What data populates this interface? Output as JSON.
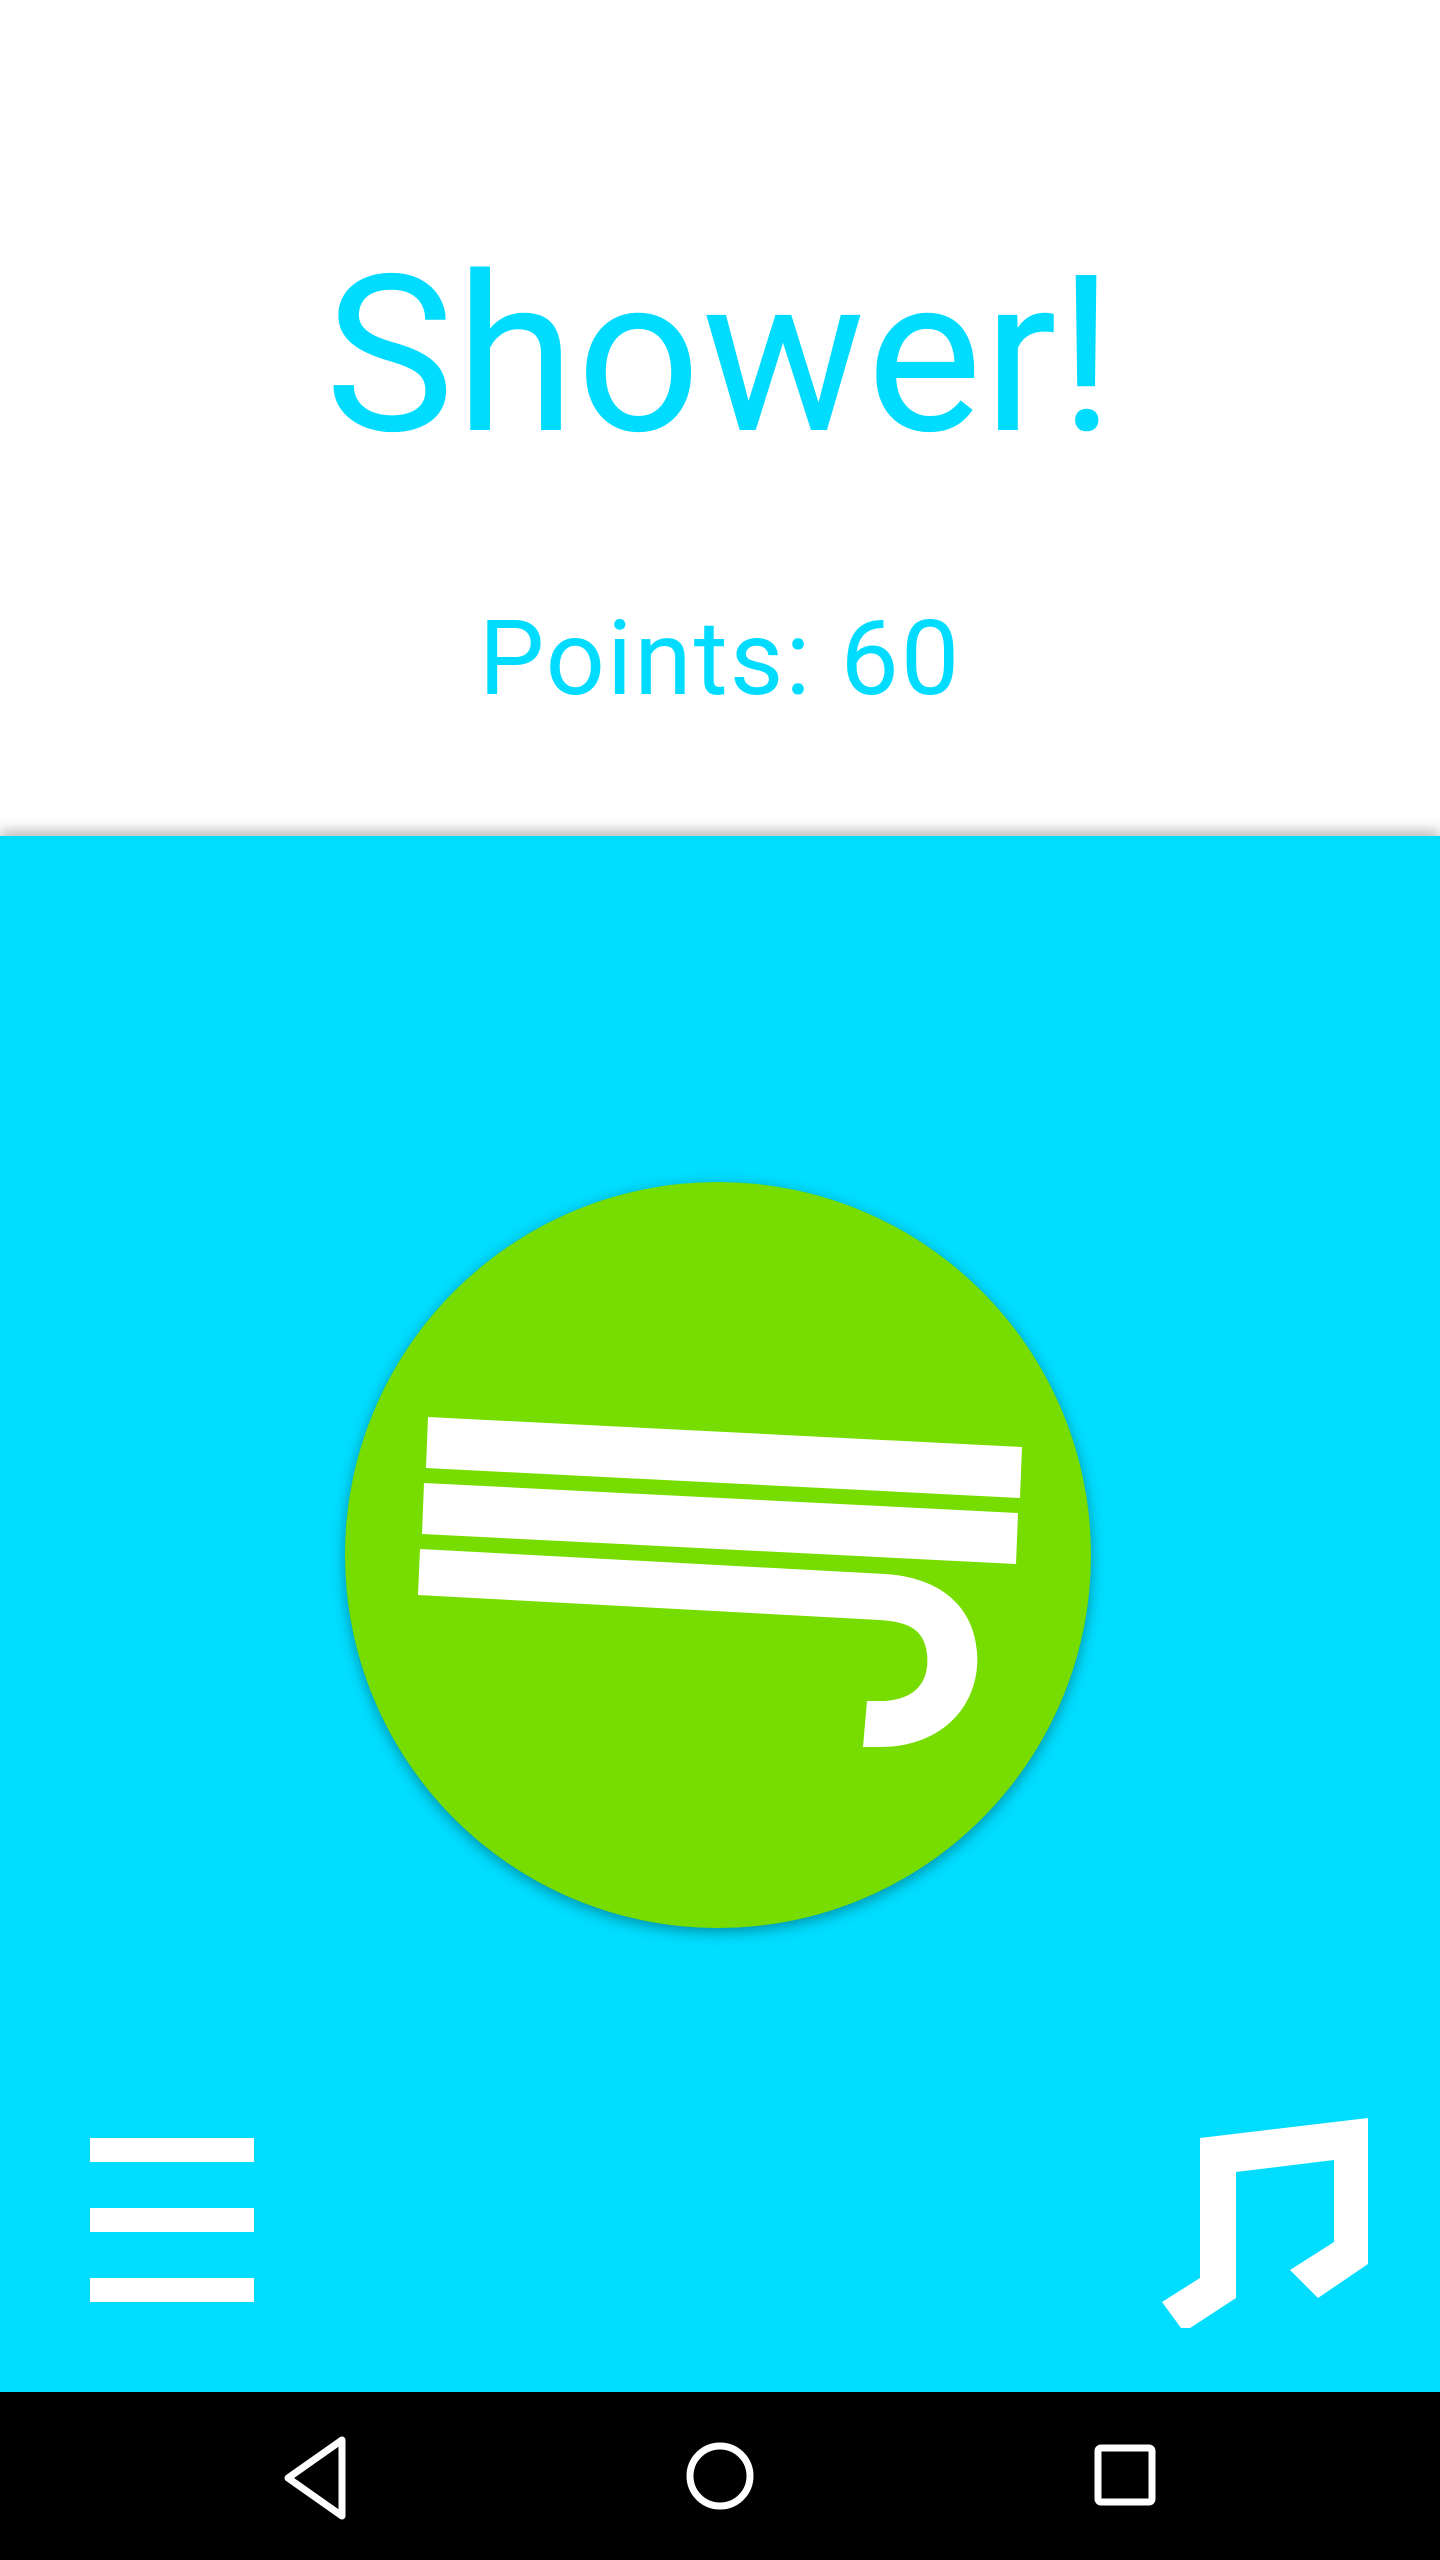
{
  "header": {
    "title": "Shower!",
    "points_label": "Points: 60"
  },
  "main": {
    "shower_button_icon": "shower-icon"
  },
  "footer": {
    "menu_icon": "hamburger-menu-icon",
    "music_icon": "music-note-icon"
  },
  "system_nav": {
    "back_icon": "back-triangle-icon",
    "home_icon": "home-circle-icon",
    "recents_icon": "recents-square-icon"
  },
  "colors": {
    "accent": "#00ddff",
    "button": "#77dd00",
    "icon": "#ffffff",
    "navbar": "#000000"
  }
}
